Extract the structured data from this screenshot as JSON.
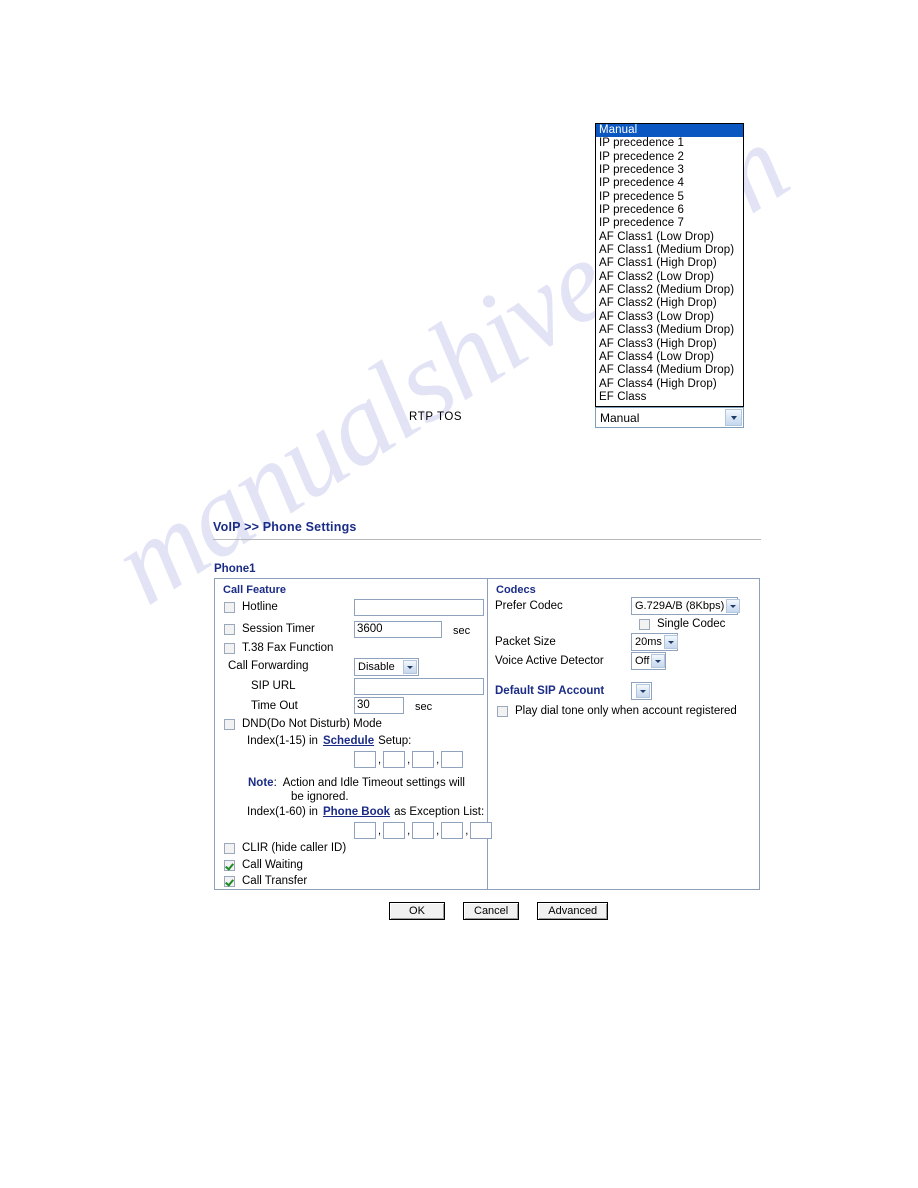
{
  "watermark": {
    "text": "manualshive.com"
  },
  "rtp_tos": {
    "label": "RTP TOS",
    "selected": "Manual",
    "options": [
      "Manual",
      "IP precedence 1",
      "IP precedence 2",
      "IP precedence 3",
      "IP precedence 4",
      "IP precedence 5",
      "IP precedence 6",
      "IP precedence 7",
      "AF Class1 (Low Drop)",
      "AF Class1 (Medium Drop)",
      "AF Class1 (High Drop)",
      "AF Class2 (Low Drop)",
      "AF Class2 (Medium Drop)",
      "AF Class2 (High Drop)",
      "AF Class3 (Low Drop)",
      "AF Class3 (Medium Drop)",
      "AF Class3 (High Drop)",
      "AF Class4 (Low Drop)",
      "AF Class4 (Medium Drop)",
      "AF Class4 (High Drop)",
      "EF Class"
    ],
    "selected_index": 0,
    "dropdown_arrow_icon": "chevron-down-icon"
  },
  "page": {
    "title": "VoIP >> Phone Settings",
    "section": "Phone1"
  },
  "call_feature": {
    "group_title": "Call Feature",
    "hotline": {
      "label": "Hotline",
      "checked": false,
      "value": ""
    },
    "session_timer": {
      "label": "Session Timer",
      "checked": false,
      "value": "3600",
      "unit": "sec"
    },
    "t38_fax": {
      "label": "T.38 Fax Function",
      "checked": false
    },
    "call_forwarding": {
      "label": "Call Forwarding",
      "value": "Disable"
    },
    "sip_url": {
      "label": "SIP URL",
      "value": ""
    },
    "time_out": {
      "label": "Time Out",
      "value": "30",
      "unit": "sec"
    },
    "dnd": {
      "label": "DND(Do Not Disturb) Mode",
      "checked": false
    },
    "schedule": {
      "prefix": "Index(1-15) in",
      "link": "Schedule",
      "suffix": "Setup:",
      "values": [
        "",
        "",
        "",
        ""
      ]
    },
    "note": {
      "word": "Note",
      "colon": ":",
      "line1": "Action and Idle Timeout settings will",
      "line2": "be ignored."
    },
    "phone_book": {
      "prefix": "Index(1-60) in",
      "link": "Phone Book",
      "suffix": "as Exception List:",
      "values": [
        "",
        "",
        "",
        "",
        ""
      ]
    },
    "clir": {
      "label": "CLIR (hide caller ID)",
      "checked": false
    },
    "call_waiting": {
      "label": "Call Waiting",
      "checked": true
    },
    "call_transfer": {
      "label": "Call Transfer",
      "checked": true
    }
  },
  "codecs": {
    "group_title": "Codecs",
    "prefer_codec": {
      "label": "Prefer Codec",
      "value": "G.729A/B (8Kbps)"
    },
    "single_codec": {
      "label": "Single Codec",
      "checked": false
    },
    "packet_size": {
      "label": "Packet Size",
      "value": "20ms"
    },
    "voice_active_detector": {
      "label": "Voice Active Detector",
      "value": "Off"
    }
  },
  "default_sip_account": {
    "group_title": "Default SIP Account",
    "value": "",
    "play_dial_tone": {
      "label": "Play dial tone only when account registered",
      "checked": false
    }
  },
  "buttons": {
    "ok": "OK",
    "cancel": "Cancel",
    "advanced": "Advanced"
  }
}
